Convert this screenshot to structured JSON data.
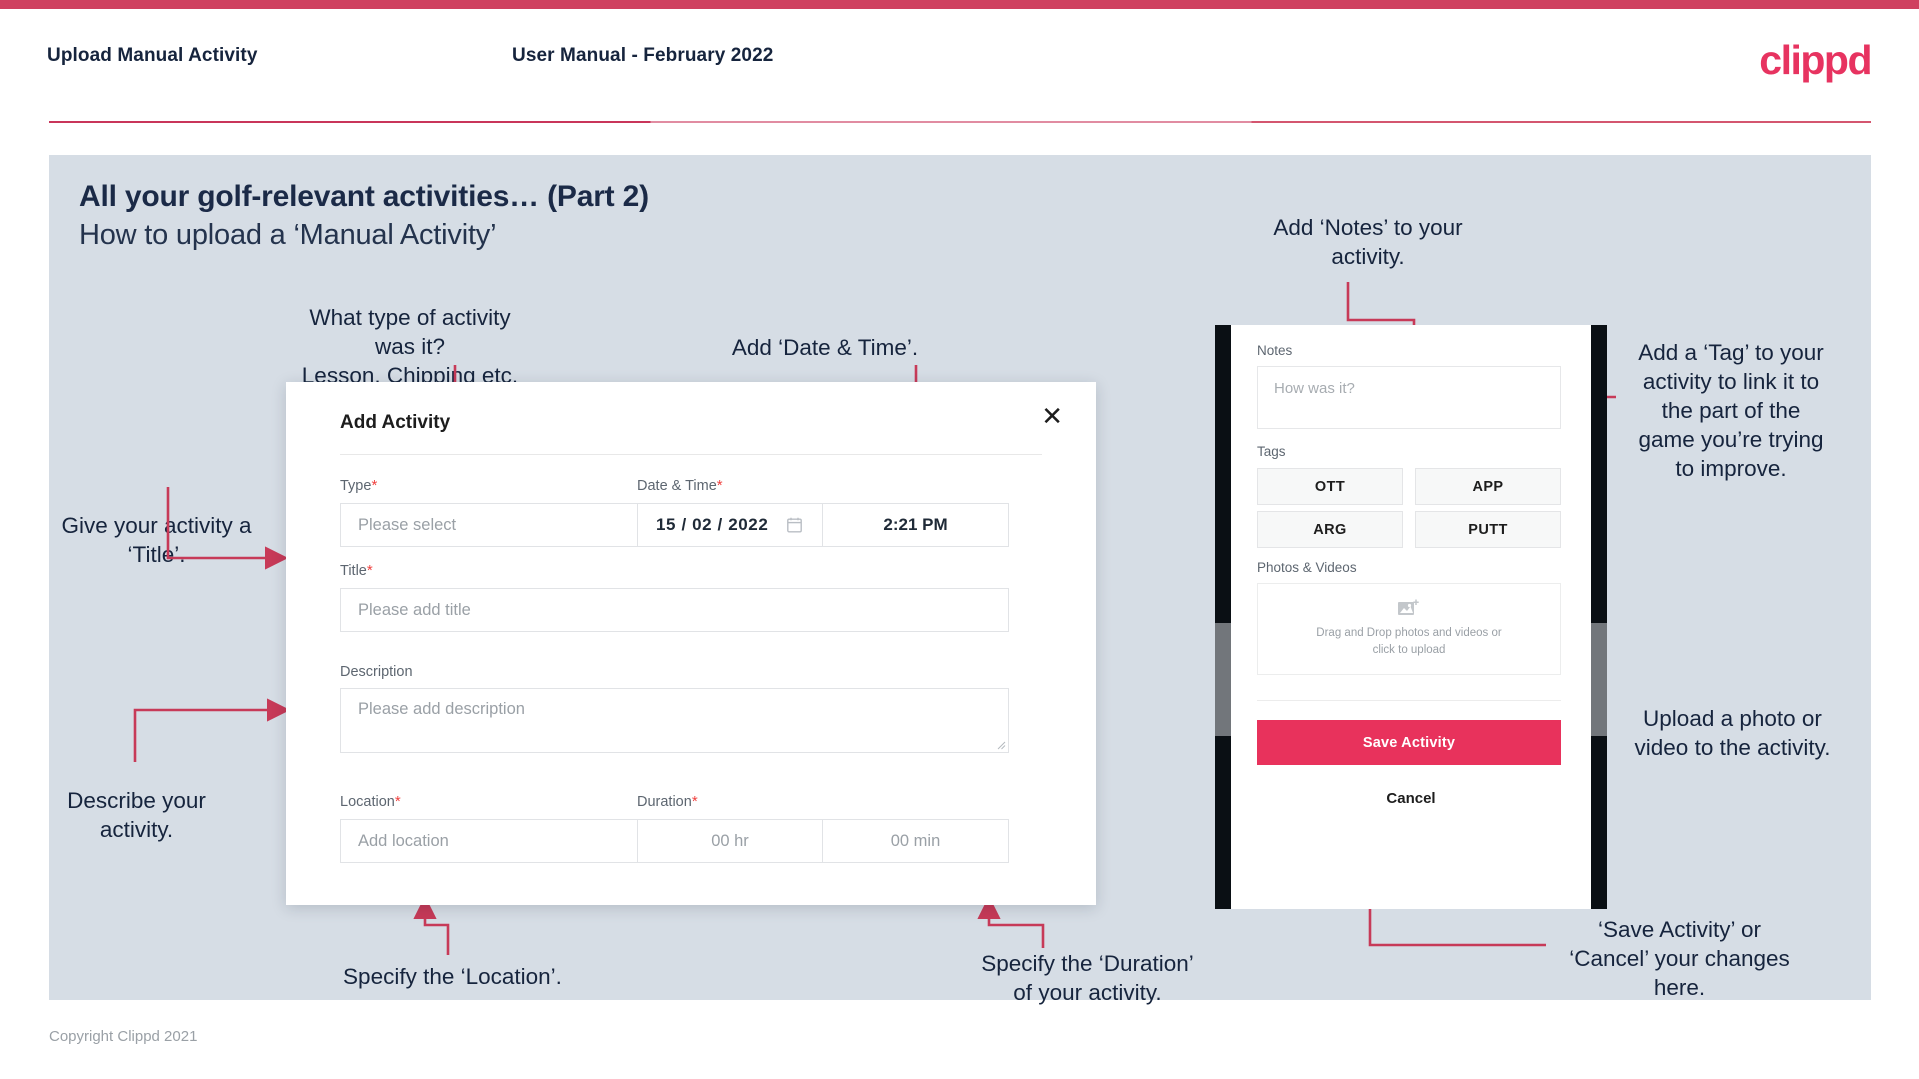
{
  "header": {
    "left_title": "Upload Manual Activity",
    "center_title": "User Manual - February 2022",
    "logo": "clippd"
  },
  "slide": {
    "title_bold": "All your golf-relevant activities… (Part 2)",
    "title_regular": "How to upload a ‘Manual Activity’"
  },
  "annotations": {
    "type": "What type of activity was it?\nLesson, Chipping etc.",
    "datetime": "Add ‘Date & Time’.",
    "title": "Give your activity a\n‘Title’.",
    "describe": "Describe your\nactivity.",
    "location": "Specify the ‘Location’.",
    "duration": "Specify the ‘Duration’\nof your activity.",
    "notes": "Add ‘Notes’ to your\nactivity.",
    "tag": "Add a ‘Tag’ to your\nactivity to link it to\nthe part of the\ngame you’re trying\nto improve.",
    "upload": "Upload a photo or\nvideo to the activity.",
    "save_cancel": "‘Save Activity’ or\n‘Cancel’ your changes\nhere."
  },
  "modal": {
    "title": "Add Activity",
    "close_icon": "close-icon",
    "type": {
      "label": "Type",
      "required": "*",
      "placeholder": "Please select",
      "chevron": "chevron-down-icon"
    },
    "datetime": {
      "label": "Date & Time",
      "required": "*",
      "day": "15",
      "sep1": "/",
      "month": "02",
      "sep2": "/",
      "year": "2022",
      "calendar_icon": "calendar-icon",
      "time": "2:21 PM"
    },
    "title_field": {
      "label": "Title",
      "required": "*",
      "placeholder": "Please add title"
    },
    "description": {
      "label": "Description",
      "placeholder": "Please add description"
    },
    "location": {
      "label": "Location",
      "required": "*",
      "placeholder": "Add location"
    },
    "duration": {
      "label": "Duration",
      "required": "*",
      "hours": "00 hr",
      "minutes": "00 min"
    }
  },
  "mobile": {
    "notes": {
      "label": "Notes",
      "placeholder": "How was it?"
    },
    "tags": {
      "label": "Tags",
      "items": [
        "OTT",
        "APP",
        "ARG",
        "PUTT"
      ]
    },
    "photos": {
      "label": "Photos & Videos",
      "icon": "add-image-icon",
      "line1": "Drag and Drop photos and videos or",
      "line2": "click to upload"
    },
    "save_label": "Save Activity",
    "cancel_label": "Cancel"
  },
  "footer": {
    "copyright": "Copyright Clippd 2021"
  },
  "colors": {
    "brand_pink": "#e8325c",
    "top_bar": "#cf4160",
    "slide_bg": "#d6dde5",
    "annotation_text": "#16243d",
    "arrow": "#c73a58",
    "required": "#f0413f"
  }
}
